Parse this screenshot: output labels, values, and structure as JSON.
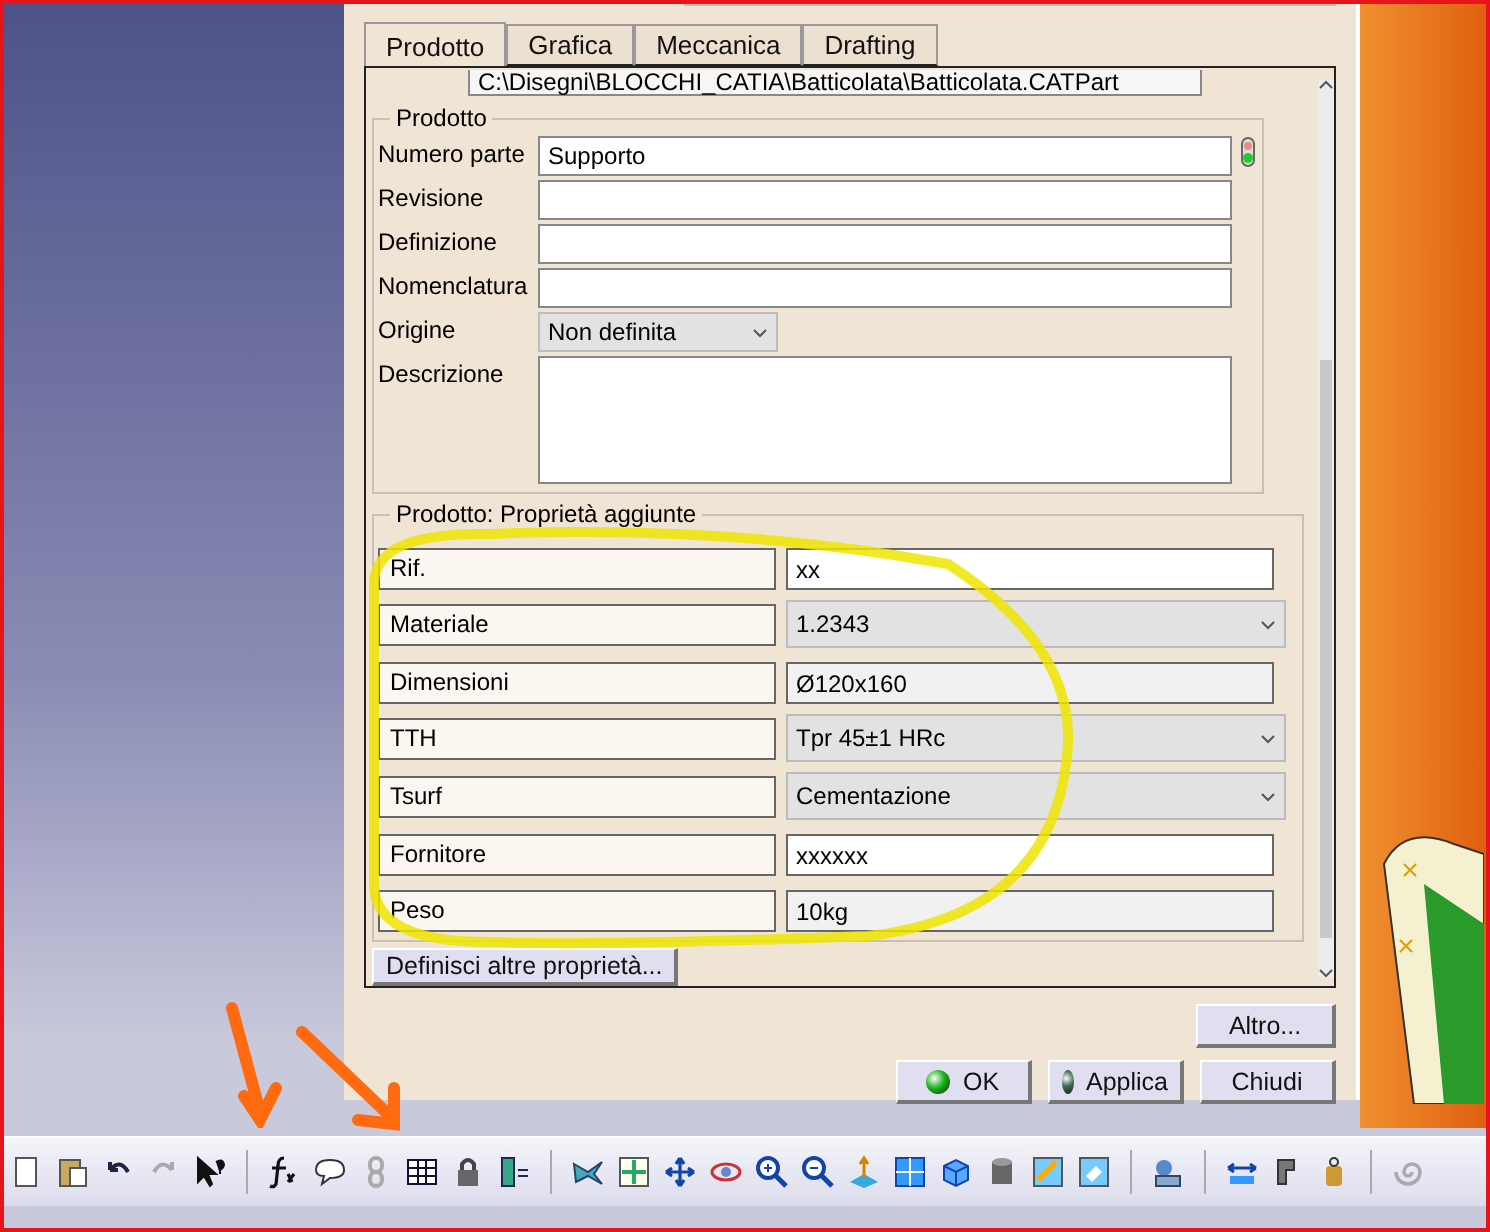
{
  "tabs": [
    {
      "label": "Prodotto",
      "selected": true
    },
    {
      "label": "Grafica",
      "selected": false
    },
    {
      "label": "Meccanica",
      "selected": false
    },
    {
      "label": "Drafting",
      "selected": false
    }
  ],
  "file_path": "C:\\Disegni\\BLOCCHI_CATIA\\Batticolata\\Batticolata.CATPart",
  "product_group": {
    "title": "Prodotto",
    "fields": [
      {
        "label": "Numero parte",
        "kind": "text",
        "value": "Supporto"
      },
      {
        "label": "Revisione",
        "kind": "text"
      },
      {
        "label": "Definizione",
        "kind": "text"
      },
      {
        "label": "Nomenclatura",
        "kind": "text"
      },
      {
        "label": "Origine",
        "kind": "dropdown",
        "value": "Non definita"
      },
      {
        "label": "Descrizione",
        "kind": "textarea"
      }
    ]
  },
  "added_properties": {
    "title": "Prodotto: Proprietà aggiunte",
    "rows": [
      {
        "label": "Rif.",
        "kind": "text",
        "value": "xx"
      },
      {
        "label": "Materiale",
        "kind": "dropdown",
        "value": "1.2343"
      },
      {
        "label": "Dimensioni",
        "kind": "readonly",
        "value": "Ø120x160"
      },
      {
        "label": "TTH",
        "kind": "dropdown",
        "value": "Tpr 45±1 HRc"
      },
      {
        "label": "Tsurf",
        "kind": "dropdown",
        "value": "Cementazione"
      },
      {
        "label": "Fornitore",
        "kind": "text",
        "value": "xxxxxx"
      },
      {
        "label": "Peso",
        "kind": "readonly",
        "value": "10kg"
      }
    ]
  },
  "define_button": "Definisci altre proprietà...",
  "more_button": "Altro...",
  "buttons": [
    {
      "label": "OK",
      "kind": "ok"
    },
    {
      "label": "Applica",
      "kind": "apply"
    },
    {
      "label": "Chiudi",
      "kind": "plain"
    }
  ]
}
